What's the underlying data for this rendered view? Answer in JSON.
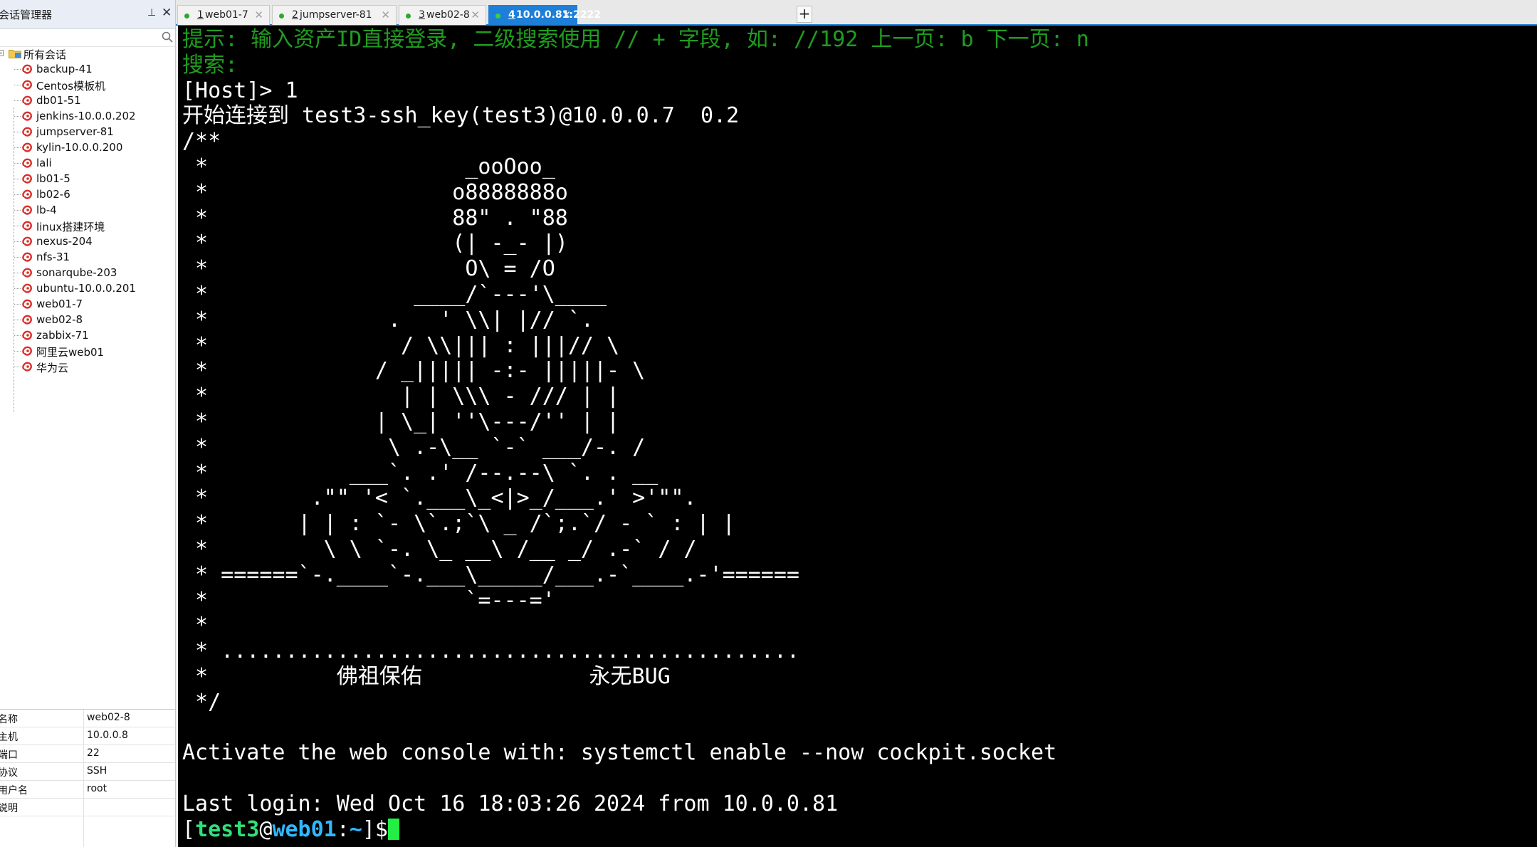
{
  "sidebar": {
    "title": "会话管理器",
    "pin_glyph": "⊥",
    "close_glyph": "✕",
    "search": {
      "value": "",
      "placeholder": ""
    },
    "root_label": "所有会话",
    "sessions": [
      "backup-41",
      "Centos模板机",
      "db01-51",
      "jenkins-10.0.0.202",
      "jumpserver-81",
      "kylin-10.0.0.200",
      "lali",
      "lb01-5",
      "lb02-6",
      "lb-4",
      "linux搭建环境",
      "nexus-204",
      "nfs-31",
      "sonarqube-203",
      "ubuntu-10.0.0.201",
      "web01-7",
      "web02-8",
      "zabbix-71",
      "阿里云web01",
      "华为云"
    ],
    "properties": [
      {
        "key": "名称",
        "value": "web02-8"
      },
      {
        "key": "主机",
        "value": "10.0.0.8"
      },
      {
        "key": "端口",
        "value": "22"
      },
      {
        "key": "协议",
        "value": "SSH"
      },
      {
        "key": "用户名",
        "value": "root"
      },
      {
        "key": "说明",
        "value": ""
      }
    ]
  },
  "tabs": [
    {
      "num": "1",
      "name": " web01-7",
      "active": false
    },
    {
      "num": "2",
      "name": " jumpserver-81",
      "active": false
    },
    {
      "num": "3",
      "name": " web02-8",
      "active": false
    },
    {
      "num": "4",
      "name": " 10.0.0.81:2222",
      "active": true
    }
  ],
  "new_tab_label": "+",
  "colors": {
    "accent": "#1e7fd8",
    "session_ok": "#2ca82c",
    "terminal_bg": "#000000",
    "hint_green": "#1f9d1f"
  },
  "terminal": {
    "hint_line": "提示: 输入资产ID直接登录, 二级搜索使用 // + 字段, 如: //192 上一页: b 下一页: n",
    "search_line": "搜索:",
    "host_prompt": "[Host]> 1",
    "connect_line": "开始连接到 test3-ssh_key(test3)@10.0.0.7  0.2",
    "banner": [
      "/**",
      " *                    _ooOoo_",
      " *                   o8888888o",
      " *                   88\" . \"88",
      " *                   (| -_- |)",
      " *                    O\\ = /O",
      " *                ____/`---'\\____",
      " *              .   ' \\\\| |// `.",
      " *               / \\\\||| : |||// \\",
      " *             / _||||| -:- |||||- \\",
      " *               | | \\\\\\ - /// | |",
      " *             | \\_| ''\\---/'' | |",
      " *              \\ .-\\__ `-` ___/-. /",
      " *           ___`. .' /--.--\\ `. . __",
      " *        .\"\" '< `.___\\_<|>_/___.' >'\"\".",
      " *       | | : `- \\`.;`\\ _ /`;.`/ - ` : | |",
      " *         \\ \\ `-. \\_ __\\ /__ _/ .-` / /",
      " * ======`-.____`-.___\\_____/___.-`____.-'======",
      " *                    `=---='",
      " *",
      " * .............................................",
      " *          佛祖保佑             永无BUG",
      " */"
    ],
    "cockpit_line": "Activate the web console with: systemctl enable --now cockpit.socket",
    "last_login_line": "Last login: Wed Oct 16 18:03:26 2024 from 10.0.0.81",
    "prompt": {
      "open": "[",
      "user": "test3",
      "at": "@",
      "host": "web01",
      "sep": ":",
      "path": "~",
      "close": "]$"
    }
  }
}
